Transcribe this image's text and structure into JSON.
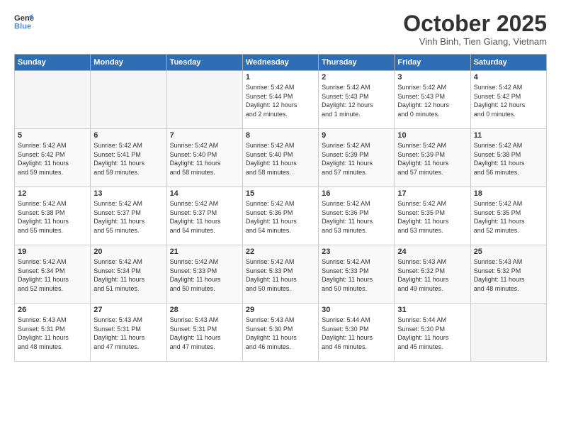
{
  "logo": {
    "line1": "General",
    "line2": "Blue"
  },
  "header": {
    "month": "October 2025",
    "location": "Vinh Binh, Tien Giang, Vietnam"
  },
  "days_of_week": [
    "Sunday",
    "Monday",
    "Tuesday",
    "Wednesday",
    "Thursday",
    "Friday",
    "Saturday"
  ],
  "weeks": [
    [
      {
        "num": "",
        "info": ""
      },
      {
        "num": "",
        "info": ""
      },
      {
        "num": "",
        "info": ""
      },
      {
        "num": "1",
        "info": "Sunrise: 5:42 AM\nSunset: 5:44 PM\nDaylight: 12 hours\nand 2 minutes."
      },
      {
        "num": "2",
        "info": "Sunrise: 5:42 AM\nSunset: 5:43 PM\nDaylight: 12 hours\nand 1 minute."
      },
      {
        "num": "3",
        "info": "Sunrise: 5:42 AM\nSunset: 5:43 PM\nDaylight: 12 hours\nand 0 minutes."
      },
      {
        "num": "4",
        "info": "Sunrise: 5:42 AM\nSunset: 5:42 PM\nDaylight: 12 hours\nand 0 minutes."
      }
    ],
    [
      {
        "num": "5",
        "info": "Sunrise: 5:42 AM\nSunset: 5:42 PM\nDaylight: 11 hours\nand 59 minutes."
      },
      {
        "num": "6",
        "info": "Sunrise: 5:42 AM\nSunset: 5:41 PM\nDaylight: 11 hours\nand 59 minutes."
      },
      {
        "num": "7",
        "info": "Sunrise: 5:42 AM\nSunset: 5:40 PM\nDaylight: 11 hours\nand 58 minutes."
      },
      {
        "num": "8",
        "info": "Sunrise: 5:42 AM\nSunset: 5:40 PM\nDaylight: 11 hours\nand 58 minutes."
      },
      {
        "num": "9",
        "info": "Sunrise: 5:42 AM\nSunset: 5:39 PM\nDaylight: 11 hours\nand 57 minutes."
      },
      {
        "num": "10",
        "info": "Sunrise: 5:42 AM\nSunset: 5:39 PM\nDaylight: 11 hours\nand 57 minutes."
      },
      {
        "num": "11",
        "info": "Sunrise: 5:42 AM\nSunset: 5:38 PM\nDaylight: 11 hours\nand 56 minutes."
      }
    ],
    [
      {
        "num": "12",
        "info": "Sunrise: 5:42 AM\nSunset: 5:38 PM\nDaylight: 11 hours\nand 55 minutes."
      },
      {
        "num": "13",
        "info": "Sunrise: 5:42 AM\nSunset: 5:37 PM\nDaylight: 11 hours\nand 55 minutes."
      },
      {
        "num": "14",
        "info": "Sunrise: 5:42 AM\nSunset: 5:37 PM\nDaylight: 11 hours\nand 54 minutes."
      },
      {
        "num": "15",
        "info": "Sunrise: 5:42 AM\nSunset: 5:36 PM\nDaylight: 11 hours\nand 54 minutes."
      },
      {
        "num": "16",
        "info": "Sunrise: 5:42 AM\nSunset: 5:36 PM\nDaylight: 11 hours\nand 53 minutes."
      },
      {
        "num": "17",
        "info": "Sunrise: 5:42 AM\nSunset: 5:35 PM\nDaylight: 11 hours\nand 53 minutes."
      },
      {
        "num": "18",
        "info": "Sunrise: 5:42 AM\nSunset: 5:35 PM\nDaylight: 11 hours\nand 52 minutes."
      }
    ],
    [
      {
        "num": "19",
        "info": "Sunrise: 5:42 AM\nSunset: 5:34 PM\nDaylight: 11 hours\nand 52 minutes."
      },
      {
        "num": "20",
        "info": "Sunrise: 5:42 AM\nSunset: 5:34 PM\nDaylight: 11 hours\nand 51 minutes."
      },
      {
        "num": "21",
        "info": "Sunrise: 5:42 AM\nSunset: 5:33 PM\nDaylight: 11 hours\nand 50 minutes."
      },
      {
        "num": "22",
        "info": "Sunrise: 5:42 AM\nSunset: 5:33 PM\nDaylight: 11 hours\nand 50 minutes."
      },
      {
        "num": "23",
        "info": "Sunrise: 5:42 AM\nSunset: 5:33 PM\nDaylight: 11 hours\nand 50 minutes."
      },
      {
        "num": "24",
        "info": "Sunrise: 5:43 AM\nSunset: 5:32 PM\nDaylight: 11 hours\nand 49 minutes."
      },
      {
        "num": "25",
        "info": "Sunrise: 5:43 AM\nSunset: 5:32 PM\nDaylight: 11 hours\nand 48 minutes."
      }
    ],
    [
      {
        "num": "26",
        "info": "Sunrise: 5:43 AM\nSunset: 5:31 PM\nDaylight: 11 hours\nand 48 minutes."
      },
      {
        "num": "27",
        "info": "Sunrise: 5:43 AM\nSunset: 5:31 PM\nDaylight: 11 hours\nand 47 minutes."
      },
      {
        "num": "28",
        "info": "Sunrise: 5:43 AM\nSunset: 5:31 PM\nDaylight: 11 hours\nand 47 minutes."
      },
      {
        "num": "29",
        "info": "Sunrise: 5:43 AM\nSunset: 5:30 PM\nDaylight: 11 hours\nand 46 minutes."
      },
      {
        "num": "30",
        "info": "Sunrise: 5:44 AM\nSunset: 5:30 PM\nDaylight: 11 hours\nand 46 minutes."
      },
      {
        "num": "31",
        "info": "Sunrise: 5:44 AM\nSunset: 5:30 PM\nDaylight: 11 hours\nand 45 minutes."
      },
      {
        "num": "",
        "info": ""
      }
    ]
  ]
}
